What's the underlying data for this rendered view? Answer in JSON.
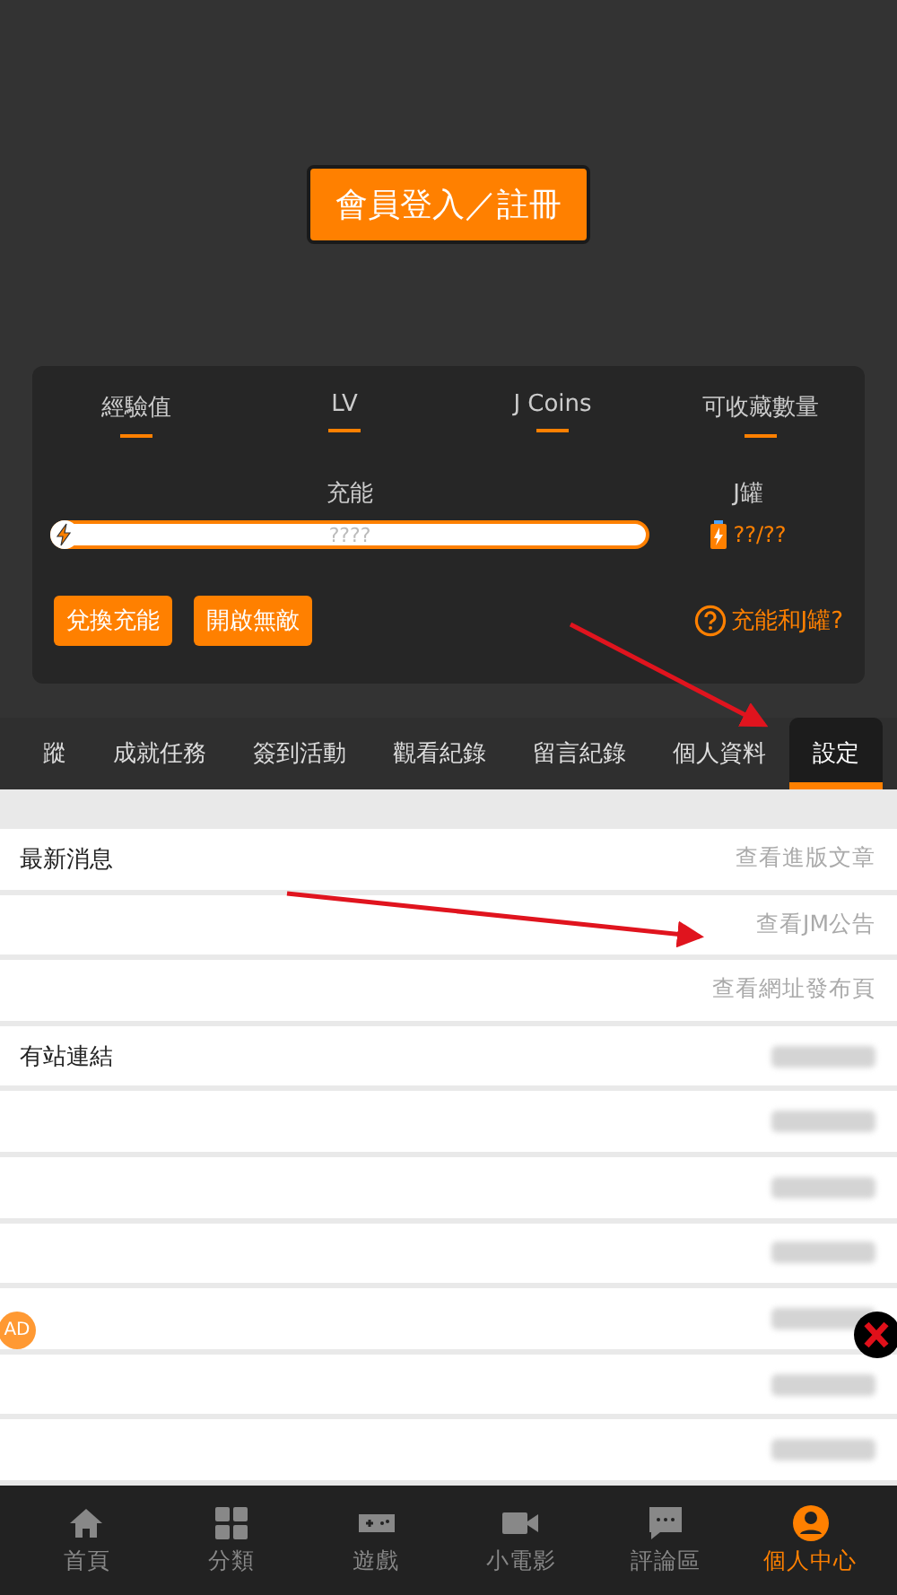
{
  "login_button": "會員登入／註冊",
  "stats": [
    {
      "label": "經驗值"
    },
    {
      "label": "LV"
    },
    {
      "label": "J Coins"
    },
    {
      "label": "可收藏數量"
    }
  ],
  "charge": {
    "label": "充能",
    "reading": "????",
    "level": 0
  },
  "jar": {
    "label": "J罐",
    "reading": "??/??"
  },
  "actions": [
    "兌換充能",
    "開啟無敵"
  ],
  "help_link": "充能和J罐?",
  "tabs": [
    {
      "label": "蹤",
      "selected": false
    },
    {
      "label": "成就任務",
      "selected": false
    },
    {
      "label": "簽到活動",
      "selected": false
    },
    {
      "label": "觀看紀錄",
      "selected": false
    },
    {
      "label": "留言紀錄",
      "selected": false
    },
    {
      "label": "個人資料",
      "selected": false
    },
    {
      "label": "設定",
      "selected": true
    }
  ],
  "rows": [
    {
      "kind": "link",
      "label": "最新消息",
      "link": "查看進版文章"
    },
    {
      "kind": "link",
      "link": "查看JM公告"
    },
    {
      "kind": "link",
      "link": "查看網址發布頁"
    },
    {
      "kind": "blurred",
      "label": "有站連結"
    },
    {
      "kind": "blurred"
    },
    {
      "kind": "blurred"
    },
    {
      "kind": "blurred"
    },
    {
      "kind": "blurred"
    },
    {
      "kind": "blurred"
    },
    {
      "kind": "blurred"
    }
  ],
  "ad_badge": "AD",
  "nav": [
    {
      "label": "首頁",
      "kind": "home",
      "selected": false
    },
    {
      "label": "分類",
      "kind": "grid",
      "selected": false
    },
    {
      "label": "遊戲",
      "kind": "gamepad",
      "selected": false
    },
    {
      "label": "小電影",
      "kind": "camera",
      "selected": false
    },
    {
      "label": "評論區",
      "kind": "chat",
      "selected": false
    },
    {
      "label": "個人中心",
      "kind": "user",
      "selected": true
    }
  ]
}
